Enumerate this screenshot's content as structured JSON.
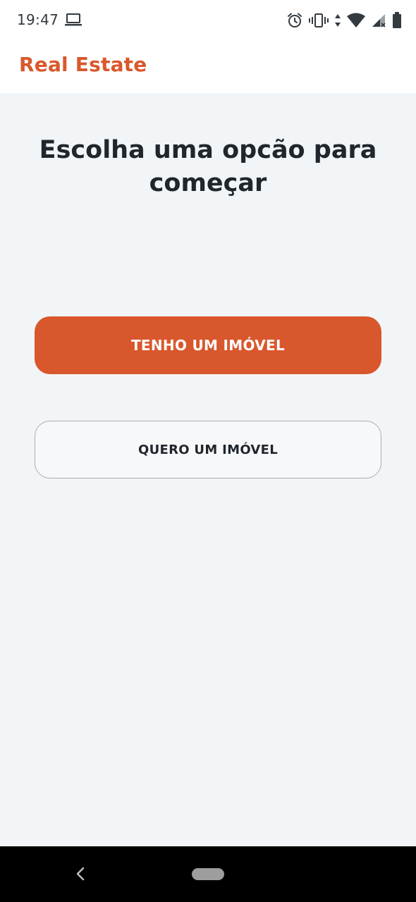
{
  "status_bar": {
    "time": "19:47",
    "icons": [
      "laptop-icon",
      "alarm-icon",
      "vibrate-icon",
      "data-arrows-icon",
      "wifi-icon",
      "signal-icon",
      "battery-icon"
    ]
  },
  "header": {
    "title": "Real Estate"
  },
  "main": {
    "headline": "Escolha uma opcão para começar",
    "primary_button_label": "TENHO UM IMÓVEL",
    "secondary_button_label": "QUERO UM IMÓVEL"
  },
  "nav_bar": {
    "icons": [
      "back-icon",
      "home-pill-icon"
    ]
  },
  "colors": {
    "accent": "#d9572c",
    "background": "#f2f5f8",
    "text": "#1f262c"
  }
}
